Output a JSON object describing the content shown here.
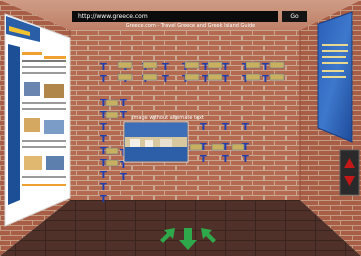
{
  "address_bar": {
    "url": "http://www.greece.com",
    "go_label": "Go"
  },
  "page": {
    "title": "Greece.com - Travel Greece and Greek Island Guide"
  },
  "center_image": {
    "caption": "Image without alternate text"
  },
  "colors": {
    "brick": "#b66a4f",
    "mortar": "#c9a88f",
    "floor": "#4a2f28",
    "t_icon": "#1f3fb0",
    "nav_arrow": "#2fa84b",
    "door_red": "#c21818"
  },
  "icons": {
    "link_marker": "T-icon",
    "nav_left": "arrow-up-left-icon",
    "nav_back": "arrow-down-icon",
    "nav_right": "arrow-up-right-icon",
    "door_up": "triangle-up-icon",
    "door_down": "triangle-down-icon"
  }
}
